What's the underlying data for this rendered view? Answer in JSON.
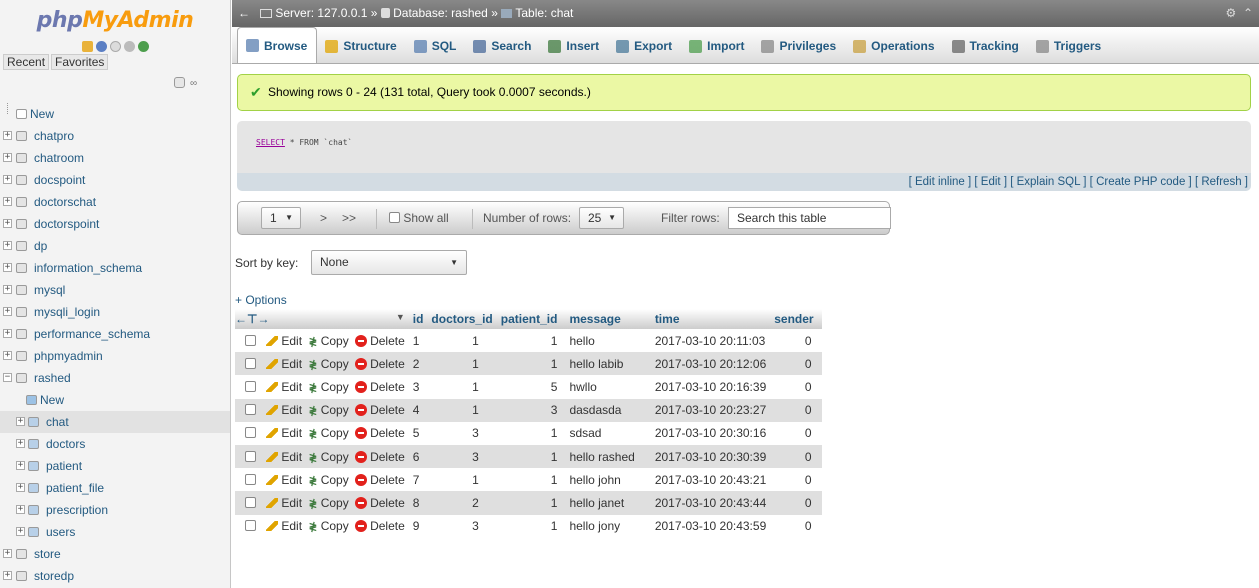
{
  "sidebar": {
    "logo_php": "php",
    "logo_myadmin": "MyAdmin",
    "recent": "Recent",
    "favorites": "Favorites",
    "new_label": "New",
    "databases": [
      {
        "name": "chatpro"
      },
      {
        "name": "chatroom"
      },
      {
        "name": "docspoint"
      },
      {
        "name": "doctorschat"
      },
      {
        "name": "doctorspoint"
      },
      {
        "name": "dp"
      },
      {
        "name": "information_schema"
      },
      {
        "name": "mysql"
      },
      {
        "name": "mysqli_login"
      },
      {
        "name": "performance_schema"
      },
      {
        "name": "phpmyadmin"
      },
      {
        "name": "rashed"
      }
    ],
    "rashed_children": {
      "new_label": "New",
      "tables": [
        "chat",
        "doctors",
        "patient",
        "patient_file",
        "prescription",
        "users"
      ]
    },
    "after_databases": [
      {
        "name": "store"
      },
      {
        "name": "storedp"
      }
    ]
  },
  "breadcrumb": {
    "server": "Server: 127.0.0.1 »",
    "database": "Database: rashed »",
    "table": "Table: chat"
  },
  "tabs": [
    {
      "label": "Browse",
      "icon": "browse-icon",
      "active": true
    },
    {
      "label": "Structure",
      "icon": "structure-icon"
    },
    {
      "label": "SQL",
      "icon": "sql-icon"
    },
    {
      "label": "Search",
      "icon": "search-icon"
    },
    {
      "label": "Insert",
      "icon": "insert-icon"
    },
    {
      "label": "Export",
      "icon": "export-icon"
    },
    {
      "label": "Import",
      "icon": "import-icon"
    },
    {
      "label": "Privileges",
      "icon": "privileges-icon"
    },
    {
      "label": "Operations",
      "icon": "operations-icon"
    },
    {
      "label": "Tracking",
      "icon": "tracking-icon"
    },
    {
      "label": "Triggers",
      "icon": "triggers-icon"
    }
  ],
  "success_message": "Showing rows 0 - 24 (131 total, Query took 0.0007 seconds.)",
  "sql": {
    "keyword": "SELECT",
    "rest": " * FROM `chat`"
  },
  "sql_links": "[ Edit inline ] [ Edit ] [ Explain SQL ] [ Create PHP code ] [ Refresh ]",
  "navigation": {
    "page_value": "1",
    "next": ">",
    "last": ">>",
    "show_all": "Show all",
    "number_of_rows_label": "Number of rows:",
    "number_of_rows_value": "25",
    "filter_rows_label": "Filter rows:",
    "filter_placeholder": "Search this table"
  },
  "sort": {
    "label": "Sort by key:",
    "value": "None"
  },
  "options_link": "+ Options",
  "table": {
    "columns": [
      "id",
      "doctors_id",
      "patient_id",
      "message",
      "time",
      "sender"
    ],
    "actions": {
      "edit": "Edit",
      "copy": "Copy",
      "delete": "Delete"
    },
    "rows": [
      {
        "id": "1",
        "doctors_id": "1",
        "patient_id": "1",
        "message": "hello",
        "time": "2017-03-10 20:11:03",
        "sender": "0"
      },
      {
        "id": "2",
        "doctors_id": "1",
        "patient_id": "1",
        "message": "hello labib",
        "time": "2017-03-10 20:12:06",
        "sender": "0"
      },
      {
        "id": "3",
        "doctors_id": "1",
        "patient_id": "5",
        "message": "hwllo",
        "time": "2017-03-10 20:16:39",
        "sender": "0"
      },
      {
        "id": "4",
        "doctors_id": "1",
        "patient_id": "3",
        "message": "dasdasda",
        "time": "2017-03-10 20:23:27",
        "sender": "0"
      },
      {
        "id": "5",
        "doctors_id": "3",
        "patient_id": "1",
        "message": "sdsad",
        "time": "2017-03-10 20:30:16",
        "sender": "0"
      },
      {
        "id": "6",
        "doctors_id": "3",
        "patient_id": "1",
        "message": "hello rashed",
        "time": "2017-03-10 20:30:39",
        "sender": "0"
      },
      {
        "id": "7",
        "doctors_id": "1",
        "patient_id": "1",
        "message": "hello john",
        "time": "2017-03-10 20:43:21",
        "sender": "0"
      },
      {
        "id": "8",
        "doctors_id": "2",
        "patient_id": "1",
        "message": "hello janet",
        "time": "2017-03-10 20:43:44",
        "sender": "0"
      },
      {
        "id": "9",
        "doctors_id": "3",
        "patient_id": "1",
        "message": "hello jony",
        "time": "2017-03-10 20:43:59",
        "sender": "0"
      }
    ]
  }
}
